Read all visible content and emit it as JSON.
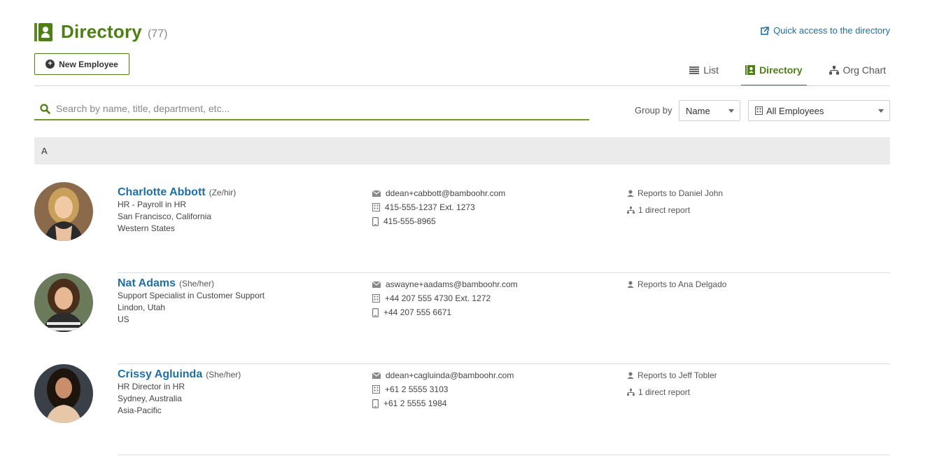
{
  "header": {
    "title": "Directory",
    "count": "(77)",
    "quick_access": "Quick access to the directory"
  },
  "toolbar": {
    "new_employee": "New Employee",
    "plus": "+"
  },
  "views": [
    {
      "label": "List",
      "icon": "list-icon",
      "active": false
    },
    {
      "label": "Directory",
      "icon": "directory-icon",
      "active": true
    },
    {
      "label": "Org Chart",
      "icon": "org-chart-icon",
      "active": false
    }
  ],
  "search": {
    "placeholder": "Search by name, title, department, etc...",
    "value": ""
  },
  "grouping": {
    "label": "Group by",
    "selected": "Name",
    "filter": "All Employees"
  },
  "group_letter": "A",
  "employees": [
    {
      "name": "Charlotte Abbott",
      "pronoun": "(Ze/hir)",
      "title": "HR - Payroll in HR",
      "location": "San Francisco, California",
      "region": "Western States",
      "email": "ddean+cabbott@bamboohr.com",
      "phone": "415-555-1237  Ext. 1273",
      "mobile": "415-555-8965",
      "reports_to": "Reports to Daniel John",
      "direct_reports": "1 direct report"
    },
    {
      "name": "Nat Adams",
      "pronoun": "(She/her)",
      "title": "Support Specialist in Customer Support",
      "location": "Lindon, Utah",
      "region": "US",
      "email": "aswayne+aadams@bamboohr.com",
      "phone": "+44 207 555 4730  Ext. 1272",
      "mobile": "+44 207 555 6671",
      "reports_to": "Reports to Ana Delgado",
      "direct_reports": ""
    },
    {
      "name": "Crissy Agluinda",
      "pronoun": "(She/her)",
      "title": "HR Director in HR",
      "location": "Sydney, Australia",
      "region": "Asia-Pacific",
      "email": "ddean+cagluinda@bamboohr.com",
      "phone": "+61 2 5555 3103",
      "mobile": "+61 2 5555 1984",
      "reports_to": "Reports to Jeff Tobler",
      "direct_reports": "1 direct report"
    }
  ],
  "colors": {
    "brand_green": "#4d7f14",
    "link_blue": "#1d6fa8"
  }
}
